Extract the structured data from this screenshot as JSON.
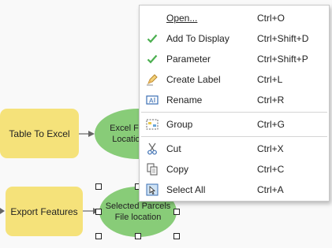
{
  "canvas": {
    "nodes": {
      "table_to_excel": "Table To Excel",
      "excel_file": "Excel File\nLocation",
      "export_features": "Export Features",
      "selected_parcels": "Selected Parcels\nFile location"
    }
  },
  "context_menu": {
    "items": [
      {
        "label": "Open...",
        "shortcut": "Ctrl+O",
        "icon": "none"
      },
      {
        "label": "Add To Display",
        "shortcut": "Ctrl+Shift+D",
        "icon": "checkmark-icon"
      },
      {
        "label": "Parameter",
        "shortcut": "Ctrl+Shift+P",
        "icon": "checkmark-icon"
      },
      {
        "label": "Create Label",
        "shortcut": "Ctrl+L",
        "icon": "label-pencil-icon"
      },
      {
        "label": "Rename",
        "shortcut": "Ctrl+R",
        "icon": "rename-icon"
      },
      {
        "label": "Group",
        "shortcut": "Ctrl+G",
        "icon": "group-icon"
      },
      {
        "label": "Cut",
        "shortcut": "Ctrl+X",
        "icon": "scissors-icon"
      },
      {
        "label": "Copy",
        "shortcut": "Ctrl+C",
        "icon": "copy-icon"
      },
      {
        "label": "Select All",
        "shortcut": "Ctrl+A",
        "icon": "select-all-icon"
      }
    ]
  },
  "colors": {
    "process_node": "#f5e27a",
    "data_node": "#88cc78",
    "check": "#4caf50"
  }
}
